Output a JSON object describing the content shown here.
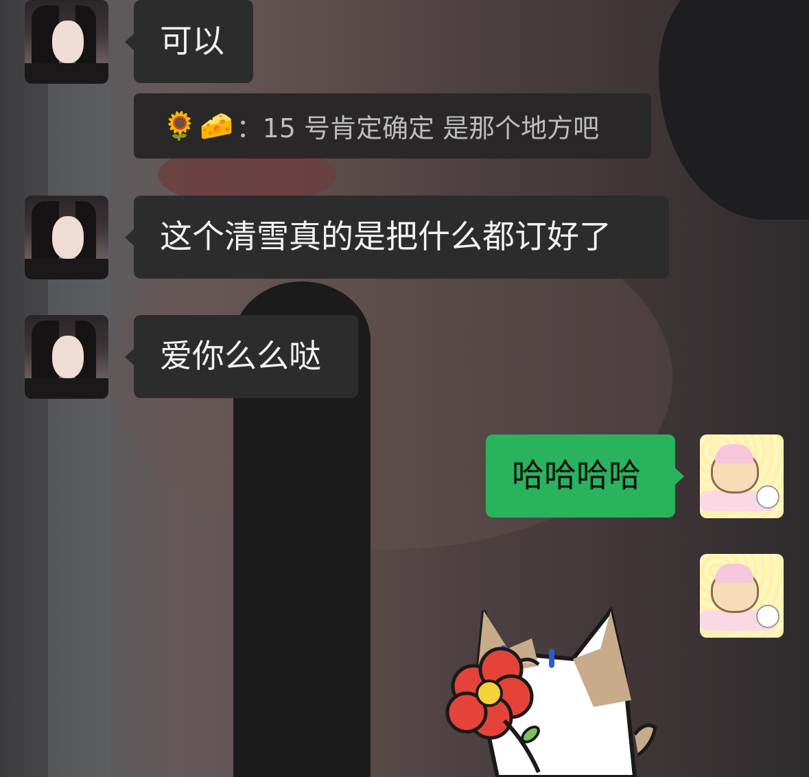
{
  "chat": {
    "messages": [
      {
        "side": "left",
        "text": "可以"
      },
      {
        "side": "left",
        "type": "quote",
        "quote_text": "：15 号肯定确定 是那个地方吧",
        "emojis": [
          "🌻",
          "🧀"
        ]
      },
      {
        "side": "left",
        "text": "这个清雪真的是把什么都订好了"
      },
      {
        "side": "left",
        "text": "爱你么么哒"
      },
      {
        "side": "right",
        "text": "哈哈哈哈"
      },
      {
        "side": "right",
        "type": "sticker",
        "sticker": "cat-holding-red-flower"
      }
    ]
  },
  "colors": {
    "outgoing_bubble": "#28b35c",
    "incoming_bubble": "#2c2c2c"
  },
  "icons": {
    "contact_avatar": "girl-photo-avatar",
    "self_avatar": "rilakkuma-avatar"
  }
}
